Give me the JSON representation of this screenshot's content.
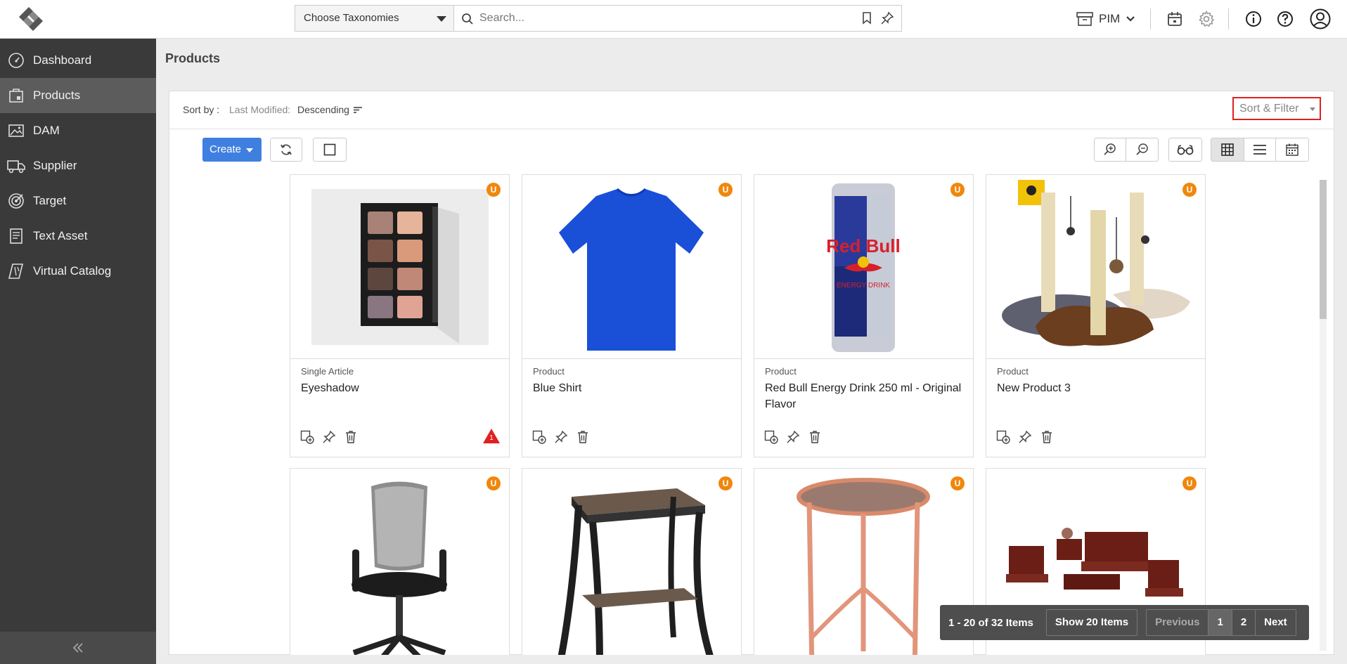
{
  "header": {
    "taxonomy_select": "Choose Taxonomies",
    "search_placeholder": "Search...",
    "workspace": "PIM"
  },
  "sidebar": {
    "items": [
      {
        "label": "Dashboard",
        "icon": "dashboard-icon"
      },
      {
        "label": "Products",
        "icon": "products-icon",
        "active": true
      },
      {
        "label": "DAM",
        "icon": "image-icon"
      },
      {
        "label": "Supplier",
        "icon": "truck-icon"
      },
      {
        "label": "Target",
        "icon": "target-icon"
      },
      {
        "label": "Text Asset",
        "icon": "document-icon"
      },
      {
        "label": "Virtual Catalog",
        "icon": "book-icon"
      }
    ]
  },
  "main": {
    "title": "Products",
    "sort": {
      "label": "Sort by :",
      "field": "Last Modified:",
      "direction": "Descending",
      "filter_button": "Sort & Filter"
    },
    "toolbar": {
      "create_label": "Create"
    },
    "cards": [
      {
        "type": "Single Article",
        "name": "Eyeshadow",
        "badge": "U",
        "warning_count": "1",
        "image": "eyeshadow-palette"
      },
      {
        "type": "Product",
        "name": "Blue Shirt",
        "badge": "U",
        "image": "blue-tshirt"
      },
      {
        "type": "Product",
        "name": "Red Bull Energy Drink 250 ml - Original Flavor",
        "badge": "U",
        "image": "red-bull-can"
      },
      {
        "type": "Product",
        "name": "New Product 3",
        "badge": "U",
        "image": "cat-scratching-post"
      },
      {
        "type": "",
        "name": "",
        "badge": "U",
        "image": "office-chair"
      },
      {
        "type": "",
        "name": "",
        "badge": "U",
        "image": "side-table"
      },
      {
        "type": "",
        "name": "",
        "badge": "U",
        "image": "copper-round-table"
      },
      {
        "type": "",
        "name": "",
        "badge": "U",
        "image": "wooden-sofa-set"
      }
    ],
    "pager": {
      "range": "1 - 20 of 32 Items",
      "page_size": "Show 20 Items",
      "previous": "Previous",
      "pages": [
        "1",
        "2"
      ],
      "current_page": "1",
      "next": "Next"
    }
  },
  "colors": {
    "sidebar_bg": "#3a3a3a",
    "sidebar_active": "#5c5c5c",
    "accent": "#3f7fe0",
    "badge": "#f0870c",
    "warning": "#e02020"
  }
}
